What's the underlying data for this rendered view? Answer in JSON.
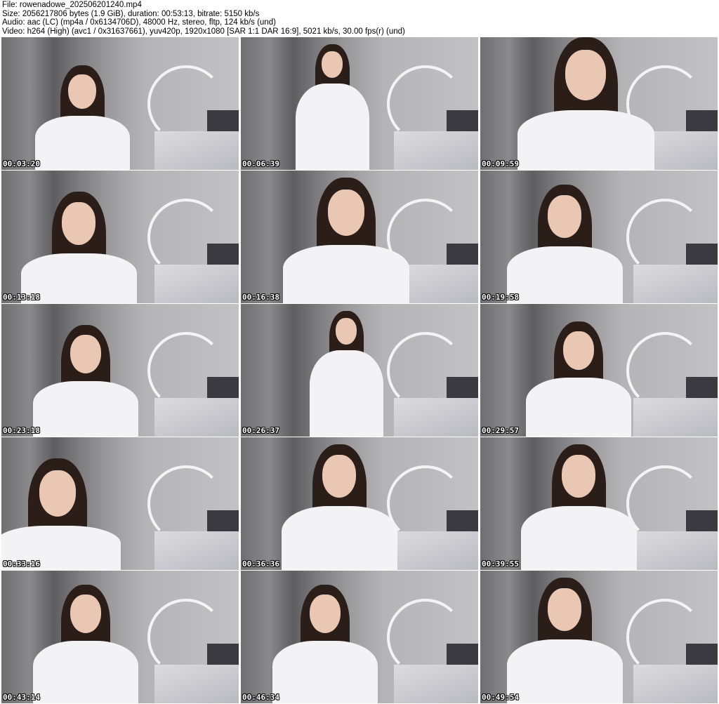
{
  "header": {
    "file": "File: rowenadowe_202506201240.mp4",
    "size": "Size: 2056217806 bytes (1.9 GiB), duration: 00:53:13, bitrate: 5150 kb/s",
    "audio": "Audio: aac (LC) (mp4a / 0x6134706D), 48000 Hz, stereo, fltp, 124 kb/s (und)",
    "video": "Video: h264 (High) (avc1 / 0x31637661), yuv420p, 1920x1080 [SAR 1:1 DAR 16:9], 5021 kb/s, 30.00 fps(r) (und)"
  },
  "thumbnails": [
    {
      "timestamp": "00:03:20"
    },
    {
      "timestamp": "00:06:39"
    },
    {
      "timestamp": "00:09:59"
    },
    {
      "timestamp": "00:13:18"
    },
    {
      "timestamp": "00:16:38"
    },
    {
      "timestamp": "00:19:58"
    },
    {
      "timestamp": "00:23:18"
    },
    {
      "timestamp": "00:26:37"
    },
    {
      "timestamp": "00:29:57"
    },
    {
      "timestamp": "00:33:16"
    },
    {
      "timestamp": "00:36:36"
    },
    {
      "timestamp": "00:39:55"
    },
    {
      "timestamp": "00:43:14"
    },
    {
      "timestamp": "00:46:34"
    },
    {
      "timestamp": "00:49:54"
    }
  ]
}
